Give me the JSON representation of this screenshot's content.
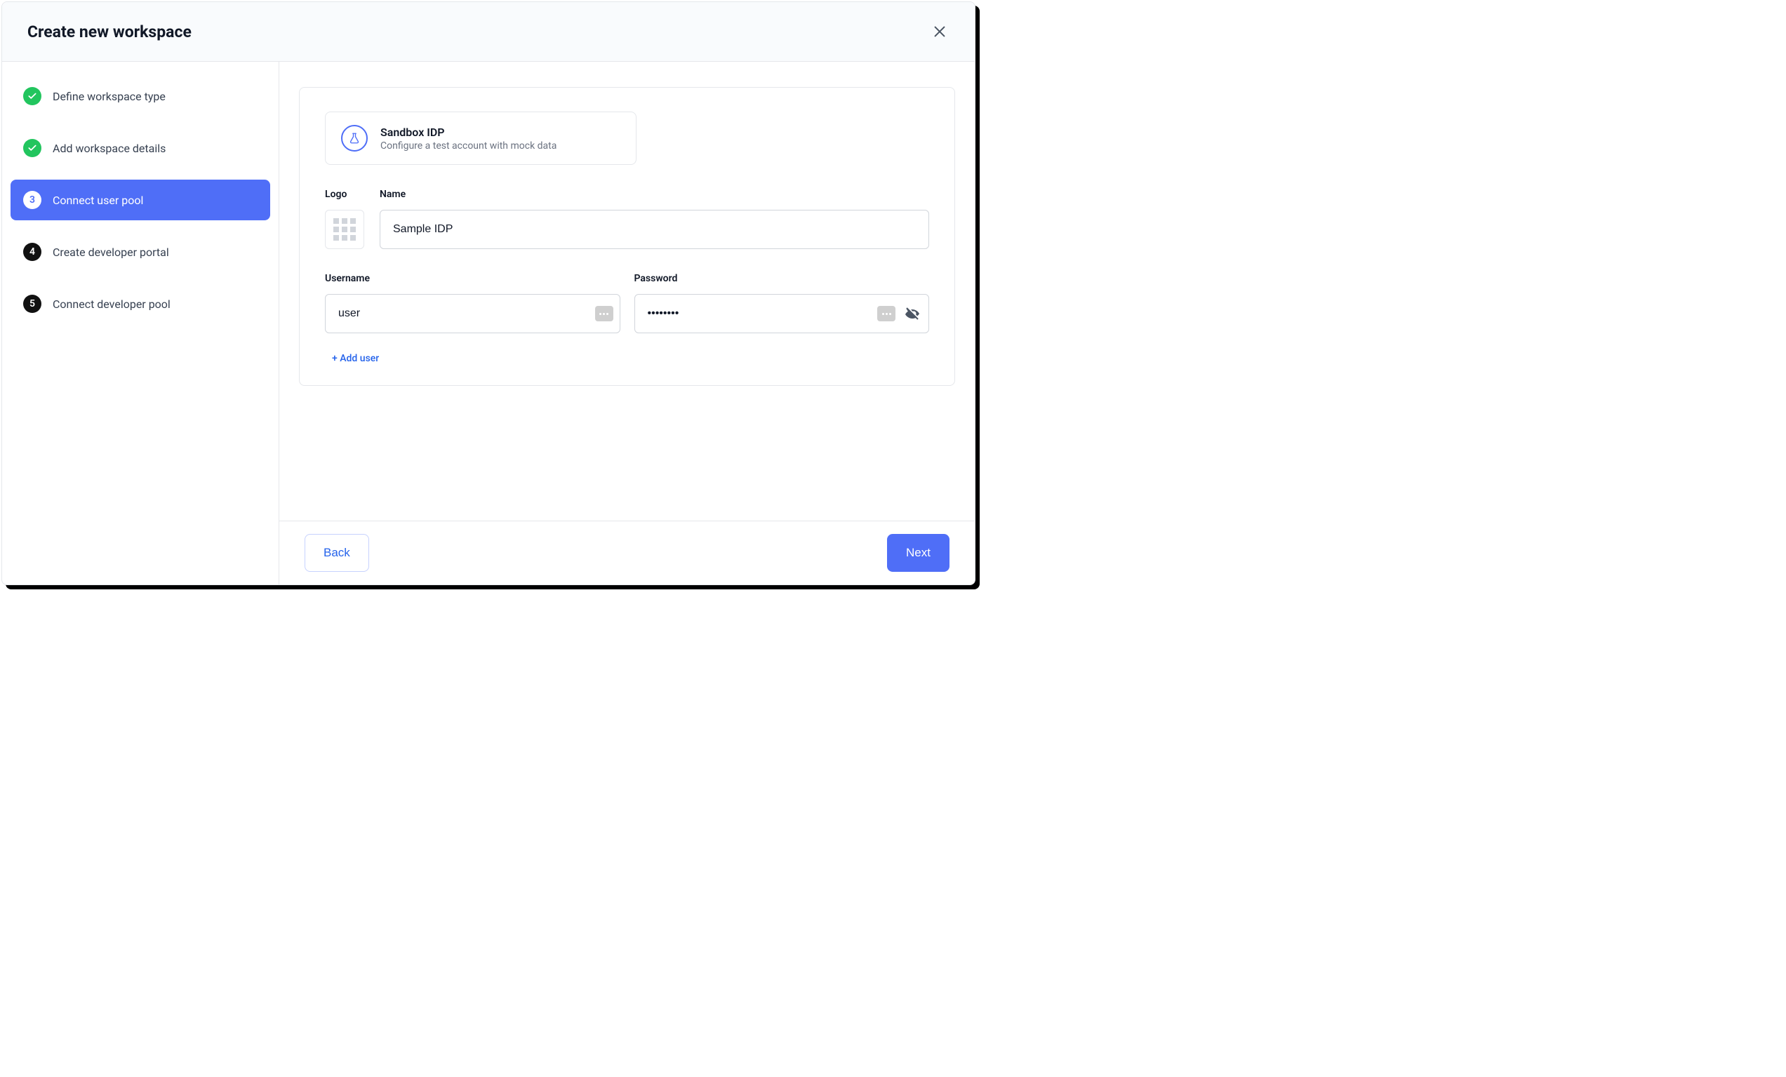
{
  "modal": {
    "title": "Create new workspace"
  },
  "steps": [
    {
      "label": "Define workspace type",
      "state": "done"
    },
    {
      "label": "Add workspace details",
      "state": "done"
    },
    {
      "label": "Connect user pool",
      "state": "current",
      "number": "3"
    },
    {
      "label": "Create developer portal",
      "state": "pending",
      "number": "4"
    },
    {
      "label": "Connect developer pool",
      "state": "pending",
      "number": "5"
    }
  ],
  "idp_card": {
    "title": "Sandbox IDP",
    "description": "Configure a test account with mock data"
  },
  "form": {
    "logo_label": "Logo",
    "name_label": "Name",
    "name_value": "Sample IDP",
    "username_label": "Username",
    "username_value": "user",
    "password_label": "Password",
    "password_value": "••••••••",
    "add_user_label": "+ Add user"
  },
  "footer": {
    "back_label": "Back",
    "next_label": "Next"
  }
}
